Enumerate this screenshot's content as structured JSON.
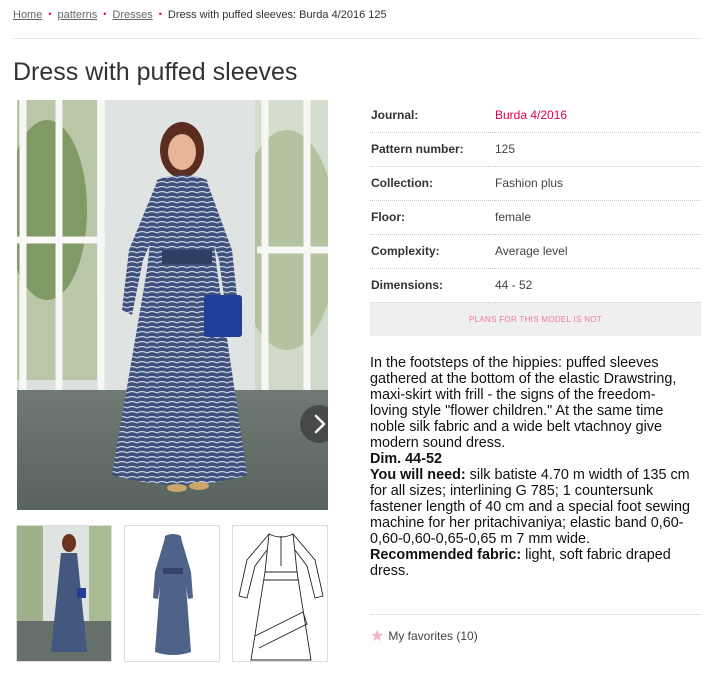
{
  "breadcrumb": {
    "home": "Home",
    "patterns": "patterns",
    "dresses": "Dresses",
    "current": "Dress with puffed sleeves: Burda 4/2016 125"
  },
  "page": {
    "title": "Dress with puffed sleeves"
  },
  "details": [
    {
      "label": "Journal:",
      "value": "Burda 4/2016"
    },
    {
      "label": "Pattern number:",
      "value": "125"
    },
    {
      "label": "Collection:",
      "value": "Fashion plus"
    },
    {
      "label": "Floor:",
      "value": "female"
    },
    {
      "label": "Complexity:",
      "value": "Average level"
    },
    {
      "label": "Dimensions:",
      "value": "44 - 52"
    }
  ],
  "plans": {
    "text": "PLANS FOR THIS MODEL IS NOT"
  },
  "description": {
    "intro": "In the footsteps of the hippies: puffed sleeves gathered at the bottom of the elastic Drawstring, maxi-skirt with frill - the signs of the freedom-loving style \"flower children.\" At the same time noble silk fabric and a wide belt vtachnoy give modern sound dress.",
    "dim_label": "Dim. 44-52",
    "need_label": "You will need:",
    "need_text": " silk batiste 4.70 m width of 135 cm for all sizes; interlining G 785; 1 countersunk fastener length of 40 cm and a special foot sewing machine for her pritachivaniya; elastic band 0,60-0,60-0,60-0,65-0,65 m 7 mm wide.",
    "fabric_label": "Recommended fabric:",
    "fabric_text": " light, soft fabric draped dress."
  },
  "favorites": {
    "label": "My favorites (10)",
    "icon": "star-icon"
  },
  "colors": {
    "accent": "#e5004c",
    "muted_pink": "#f07a9a",
    "dress_blue": "#3d4f7a"
  }
}
